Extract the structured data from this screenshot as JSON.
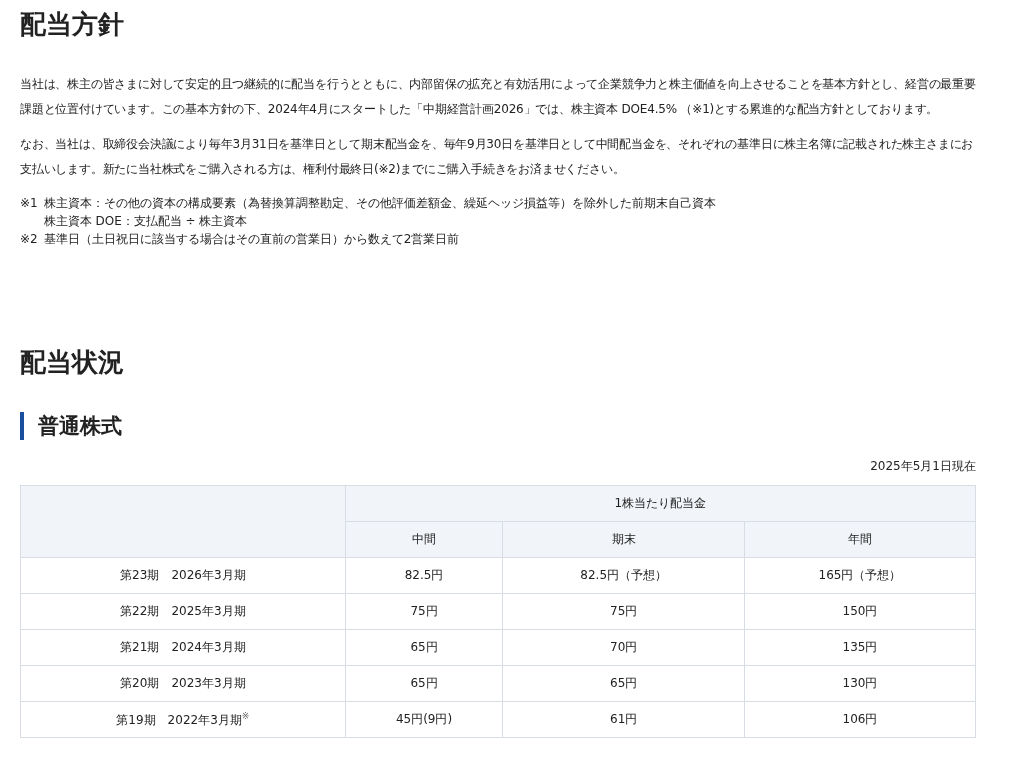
{
  "policy": {
    "title": "配当方針",
    "paragraphs": [
      "当社は、株主の皆さまに対して安定的且つ継続的に配当を行うとともに、内部留保の拡充と有効活用によって企業競争力と株主価値を向上させることを基本方針とし、経営の最重要課題と位置付けています。この基本方針の下、2024年4月にスタートした「中期経営計画2026」では、株主資本 DOE4.5% （※1)とする累進的な配当方針としております。",
      "なお、当社は、取締役会決議により毎年3月31日を基準日として期末配当金を、毎年9月30日を基準日として中間配当金を、それぞれの基準日に株主名簿に記載された株主さまにお支払いします。新たに当社株式をご購入される方は、権利付最終日(※2)までにご購入手続きをお済ませください。"
    ],
    "notes": [
      {
        "mark": "※1",
        "lines": [
          "株主資本：その他の資本の構成要素（為替換算調整勘定、その他評価差額金、繰延ヘッジ損益等）を除外した前期末自己資本",
          "株主資本 DOE：支払配当 ÷ 株主資本"
        ]
      },
      {
        "mark": "※2",
        "lines": [
          "基準日（土日祝日に該当する場合はその直前の営業日）から数えて2営業日前"
        ]
      }
    ]
  },
  "status": {
    "title": "配当状況",
    "subtitle": "普通株式",
    "as_of": "2025年5月1日現在",
    "table": {
      "group_header": "1株当たり配当金",
      "columns": [
        "中間",
        "期末",
        "年間"
      ],
      "rows": [
        {
          "period": "第23期　2026年3月期",
          "values": [
            "82.5円",
            "82.5円（予想）",
            "165円（予想）"
          ]
        },
        {
          "period": "第22期　2025年3月期",
          "values": [
            "75円",
            "75円",
            "150円"
          ]
        },
        {
          "period": "第21期　2024年3月期",
          "values": [
            "65円",
            "70円",
            "135円"
          ]
        },
        {
          "period": "第20期　2023年3月期",
          "values": [
            "65円",
            "65円",
            "130円"
          ]
        },
        {
          "period": "第19期　2022年3月期$^{※}$",
          "values": [
            "45円(9円)",
            "61円",
            "106円"
          ]
        }
      ]
    }
  }
}
